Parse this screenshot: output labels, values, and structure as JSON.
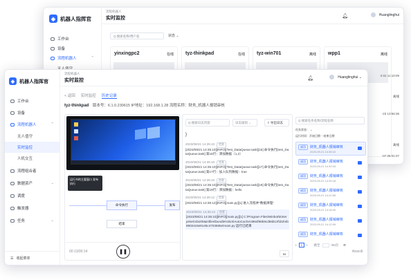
{
  "back": {
    "app_title": "机器人指挥官",
    "breadcrumb_small": "流程机器人",
    "page_title": "实时监控",
    "user": "Huanglinghui",
    "search_placeholder": "Q 搜索名称/用户名",
    "status_filter": "状态",
    "nav": [
      {
        "label": "工作台",
        "icon": "desk-icon"
      },
      {
        "label": "设备",
        "icon": "device-icon"
      },
      {
        "label": "流程机器人",
        "icon": "robot-icon",
        "active": true
      }
    ],
    "nav_sub": [
      {
        "label": "无人值守"
      }
    ],
    "cards": [
      {
        "name": "yinxingpc2",
        "status": "在线"
      },
      {
        "name": "tyz-thinkpad",
        "status": "在线"
      },
      {
        "name": "tyz-win701",
        "status": "离线"
      },
      {
        "name": "wpp1",
        "status": "离线"
      }
    ],
    "right_stamps": [
      "3-31 11:10:09",
      "离线",
      "-23 13:56:36",
      "离线",
      "-07 06:01:07"
    ]
  },
  "front": {
    "app_title": "机器人指挥官",
    "breadcrumb_small": "流程机器人",
    "page_title": "实时监控",
    "user": "Huanglinghui",
    "nav": [
      {
        "label": "工作台",
        "icon": "desk-icon"
      },
      {
        "label": "设备",
        "icon": "device-icon"
      },
      {
        "label": "流程机器人",
        "icon": "robot-icon",
        "active": true
      }
    ],
    "nav_sub": [
      {
        "label": "无人值守"
      },
      {
        "label": "实时监控",
        "selected": true
      },
      {
        "label": "人机交互"
      }
    ],
    "nav_more": [
      {
        "label": "流程组合者",
        "icon": "flow-icon"
      },
      {
        "label": "数据资产",
        "icon": "data-icon"
      },
      {
        "label": "调度",
        "icon": "schedule-icon"
      },
      {
        "label": "触发器",
        "icon": "trigger-icon"
      },
      {
        "label": "任务",
        "icon": "task-icon"
      }
    ],
    "collapse_label": "收起菜单",
    "tabs": [
      {
        "label": "< 返回"
      },
      {
        "label": "实时监控"
      },
      {
        "label": "历史记录",
        "active": true
      }
    ],
    "device_name": "tyz-thinkpad",
    "meta": "版本号：6.1.0.230615  IP地址：192.168.1.28  流程名称：财务_机器人报销审核",
    "video": {
      "toast": "运行书的主要窗口 发布执行",
      "node1": "命令执行",
      "node2": "发布",
      "node3": "结束",
      "time": "00:13/00:14"
    },
    "log": {
      "search_placeholder": "搜索日志内容",
      "level_placeholder": "日志级别",
      "export_label": "导出日志",
      "entries": [
        {
          "ts": "2023/08/21 14:35:10",
          "tag": "信息",
          "text": "[2023/08/21 14:35:10][INFO][Test_DataQueue.task][15] 命令执行[test_DataQueue.task] 第15行：添加数据（1,2）"
        },
        {
          "ts": "2023/08/21 14:35:10",
          "tag": "信息",
          "text": "[2023/08/21 14:35:10][INFO][Test_DataQueue.task][17] 命令执行[test_DataQueue.task] 第17行：加入队列数据：true"
        },
        {
          "ts": "2023/08/21 14:35:10",
          "tag": "信息",
          "text": "[2023/08/21 14:35:10][INFO][Test_DataQueue.task][19] 命令执行[test_DataQueue.task] 第19行：添加数据：hello"
        },
        {
          "ts": "2023/08/21 14:36:12",
          "tag": "信息",
          "text": "[2023/08/21 14:36:12][INFO][main.py][1] 进入流程并\"数据清理\""
        },
        {
          "ts": "2023/08/21 14:35:12",
          "tag": "信息",
          "text": "[2023/08/21 14:35:10][INFO][main.py][1] C:\\Program Files\\Winbot\\Enterprise\\robot\\Mainfiles\\bundle\\robot\\AutoCache\\4864f66b9cd56b13f1b3\\4b89024c5e9145c4703565e\\main.py 运行已结束"
        }
      ],
      "speed": "1x"
    },
    "side": {
      "search_placeholder": "搜索任务名称/流程名称",
      "filter_status": "任务状态：",
      "filter_time": "运行时间：开始日期  ~  结束日期",
      "records": [
        {
          "tag": "成功",
          "name": "财务_机器人报销审核",
          "time": "2023-09-21 14:35:10",
          "selected": true
        },
        {
          "tag": "成功",
          "name": "财务_机器人报销审核",
          "time": "2023-09-21 14:32:04"
        },
        {
          "tag": "成功",
          "name": "财务_机器人报销审核",
          "time": "2023-09-21 14:26:18"
        },
        {
          "tag": "成功",
          "name": "财务_机器人报销审核",
          "time": "2023-09-21 14:22:55"
        },
        {
          "tag": "成功",
          "name": "财务_机器人报销审核",
          "time": "2023-09-21 14:18:40"
        },
        {
          "tag": "成功",
          "name": "财务_机器人报销审核",
          "time": "2023-09-21 14:12:09"
        },
        {
          "tag": "成功",
          "name": "财务_机器人报销审核",
          "time": ""
        }
      ],
      "page_current": "1",
      "goto_label": "跳至",
      "page_total": "/88页",
      "total": "共880条"
    }
  }
}
